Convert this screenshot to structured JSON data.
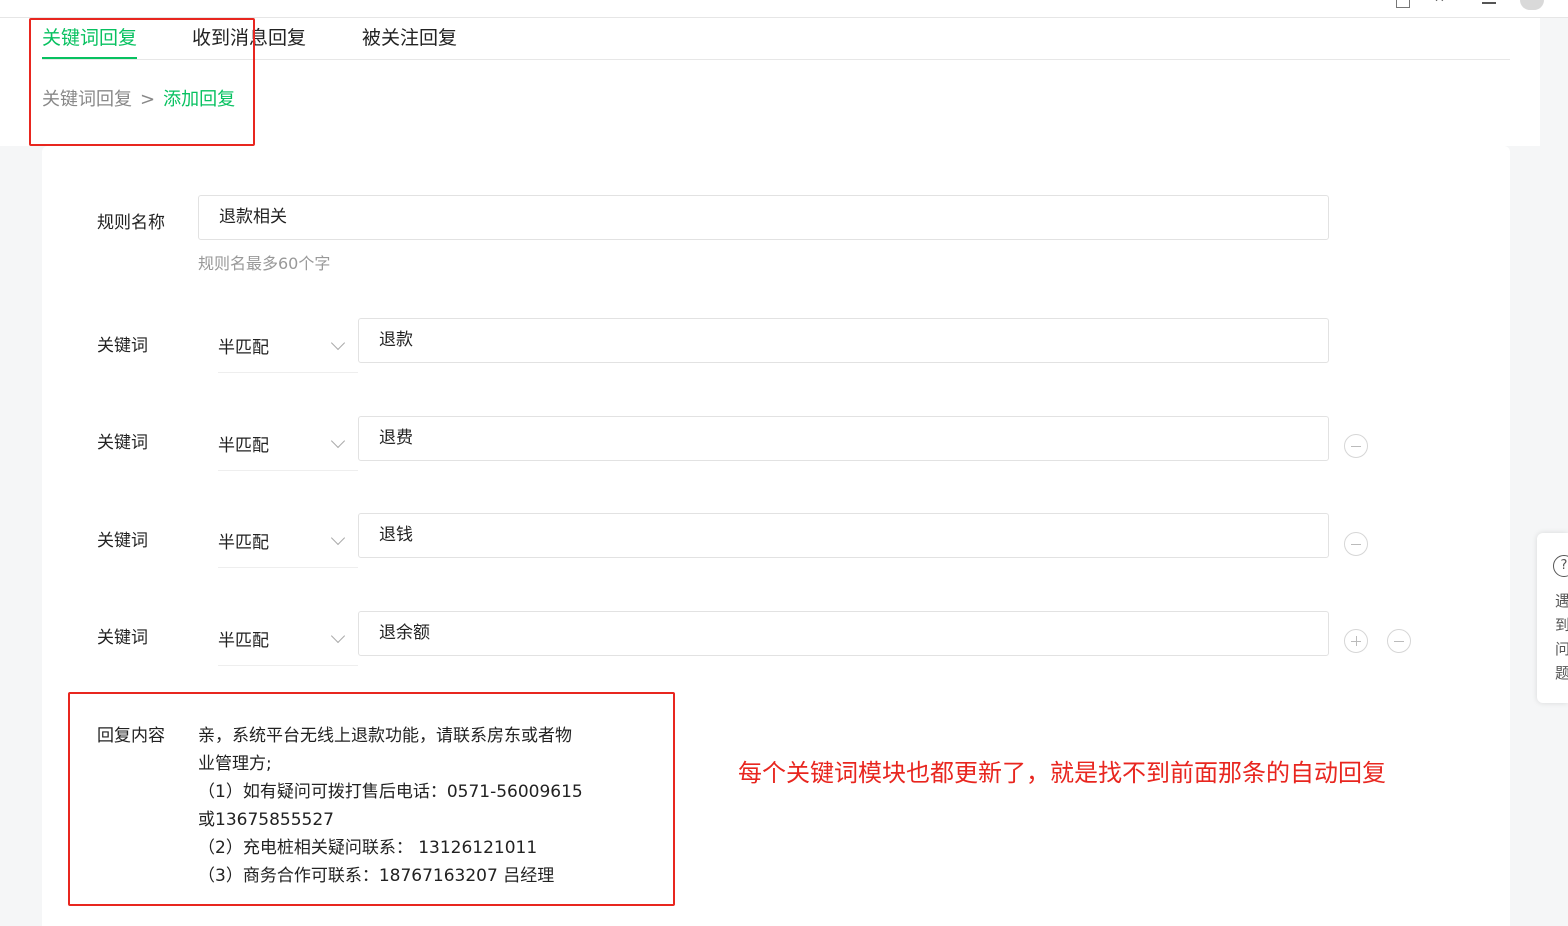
{
  "tabs": [
    {
      "label": "关键词回复",
      "active": true
    },
    {
      "label": "收到消息回复",
      "active": false
    },
    {
      "label": "被关注回复",
      "active": false
    }
  ],
  "breadcrumb": {
    "parent": "关键词回复",
    "separator": ">",
    "current": "添加回复"
  },
  "form": {
    "rule_label": "规则名称",
    "rule_value": "退款相关",
    "rule_hint": "规则名最多60个字",
    "keyword_label": "关键词",
    "keywords": [
      {
        "match": "半匹配",
        "value": "退款"
      },
      {
        "match": "半匹配",
        "value": "退费"
      },
      {
        "match": "半匹配",
        "value": "退钱"
      },
      {
        "match": "半匹配",
        "value": "退余额"
      }
    ],
    "reply_label": "回复内容",
    "reply_lines": [
      "亲，系统平台无线上退款功能，请联系房东或者物",
      "业管理方;",
      "（1）如有疑问可拨打售后电话：0571-56009615",
      "或13675855527",
      "（2）充电桩相关疑问联系： 13126121011",
      "（3）商务合作可联系：18767163207 吕经理"
    ]
  },
  "annotation": "每个关键词模块也都更新了，就是找不到前面那条的自动回复",
  "helper": {
    "icon": "?",
    "text": "遇到问题"
  },
  "colors": {
    "accent": "#07c160",
    "annotation_red": "#e8261f"
  }
}
